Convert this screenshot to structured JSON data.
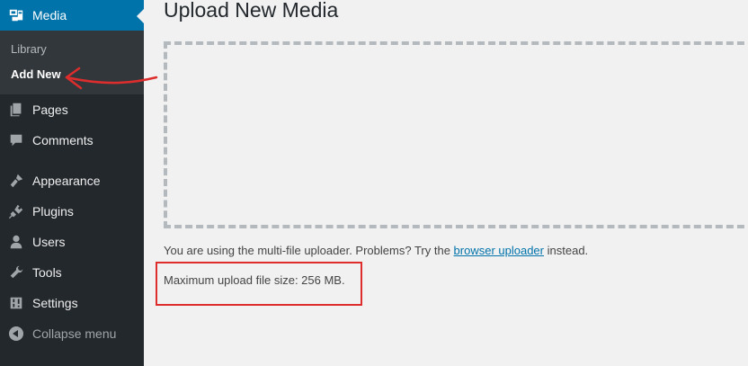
{
  "sidebar": {
    "media": {
      "label": "Media",
      "icon": "media-icon"
    },
    "submenu": [
      {
        "label": "Library"
      },
      {
        "label": "Add New",
        "current": true
      }
    ],
    "items": [
      {
        "label": "Pages",
        "icon": "pages-icon"
      },
      {
        "label": "Comments",
        "icon": "comments-icon"
      },
      {
        "label": "Appearance",
        "icon": "appearance-icon"
      },
      {
        "label": "Plugins",
        "icon": "plugins-icon"
      },
      {
        "label": "Users",
        "icon": "users-icon"
      },
      {
        "label": "Tools",
        "icon": "tools-icon"
      },
      {
        "label": "Settings",
        "icon": "settings-icon"
      }
    ],
    "collapse_label": "Collapse menu"
  },
  "main": {
    "title": "Upload New Media",
    "uploader_text_before": "You are using the multi-file uploader. Problems? Try the",
    "uploader_link": "browser uploader",
    "uploader_text_after": "instead.",
    "max_size_text": "Maximum upload file size: 256 MB."
  },
  "colors": {
    "sidebar_bg": "#23282d",
    "submenu_bg": "#32373c",
    "active_blue": "#0073aa",
    "annotation_red": "#dd2d2d"
  }
}
